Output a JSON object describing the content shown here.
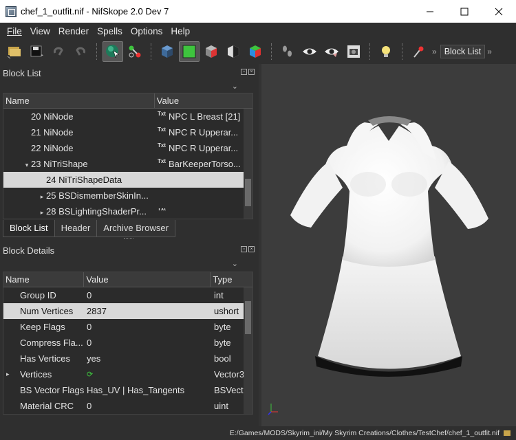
{
  "window": {
    "title": "chef_1_outfit.nif - NifSkope 2.0 Dev 7"
  },
  "menu": [
    "File",
    "View",
    "Render",
    "Spells",
    "Options",
    "Help"
  ],
  "toolbar": {
    "icons": [
      "open-icon",
      "save-icon",
      "undo-icon",
      "redo-icon",
      "select-icon",
      "connect-icon",
      "cube-dark-icon",
      "cube-green-icon",
      "cube-red-icon",
      "cube-split-icon",
      "cube-color-icon",
      "footprints-icon",
      "eye-icon",
      "eye-half-icon",
      "screenshot-icon",
      "lightbulb-icon",
      "pin-icon"
    ],
    "block_list_label": "Block List"
  },
  "block_list": {
    "title": "Block List",
    "columns": [
      "Name",
      "Value"
    ],
    "rows": [
      {
        "name": "20 NiNode",
        "value": "NPC L Breast [21]",
        "indent": 1,
        "arrow": "",
        "txt": true,
        "selected": false
      },
      {
        "name": "21 NiNode",
        "value": "NPC R Upperar...",
        "indent": 1,
        "arrow": "",
        "txt": true,
        "selected": false
      },
      {
        "name": "22 NiNode",
        "value": "NPC R Upperar...",
        "indent": 1,
        "arrow": "",
        "txt": true,
        "selected": false
      },
      {
        "name": "23 NiTriShape",
        "value": "BarKeeperTorso...",
        "indent": 1,
        "arrow": "down",
        "txt": true,
        "selected": false
      },
      {
        "name": "24 NiTriShapeData",
        "value": "",
        "indent": 2,
        "arrow": "",
        "txt": false,
        "selected": true
      },
      {
        "name": "25 BSDismemberSkinIn...",
        "value": "",
        "indent": 2,
        "arrow": "right",
        "txt": false,
        "selected": false
      },
      {
        "name": "28 BSLightingShaderPr...",
        "value": "",
        "indent": 2,
        "arrow": "right",
        "txt": true,
        "selected": false
      }
    ],
    "tabs": [
      "Block List",
      "Header",
      "Archive Browser"
    ]
  },
  "block_details": {
    "title": "Block Details",
    "columns": [
      "Name",
      "Value",
      "Type"
    ],
    "rows": [
      {
        "name": "Group ID",
        "value": "0",
        "type": "int",
        "arrow": "",
        "selected": false
      },
      {
        "name": "Num Vertices",
        "value": "2837",
        "type": "ushort",
        "arrow": "",
        "selected": true
      },
      {
        "name": "Keep Flags",
        "value": "0",
        "type": "byte",
        "arrow": "",
        "selected": false
      },
      {
        "name": "Compress Fla...",
        "value": "0",
        "type": "byte",
        "arrow": "",
        "selected": false
      },
      {
        "name": "Has Vertices",
        "value": "yes",
        "type": "bool",
        "arrow": "",
        "selected": false
      },
      {
        "name": "Vertices",
        "value": "",
        "type": "Vector3",
        "arrow": "right",
        "selected": false
      },
      {
        "name": "BS Vector Flags",
        "value": "Has_UV | Has_Tangents",
        "type": "BSVecto",
        "arrow": "",
        "selected": false
      },
      {
        "name": "Material CRC",
        "value": "0",
        "type": "uint",
        "arrow": "",
        "selected": false
      }
    ]
  },
  "status": {
    "path": "E:/Games/MODS/Skyrim_ini/My Skyrim Creations/Clothes/TestChef/chef_1_outfit.nif"
  },
  "colors": {
    "bg": "#333333",
    "viewport": "#3c3c3c",
    "selected_row": "#d8d8d8",
    "green": "#3ec43e"
  }
}
